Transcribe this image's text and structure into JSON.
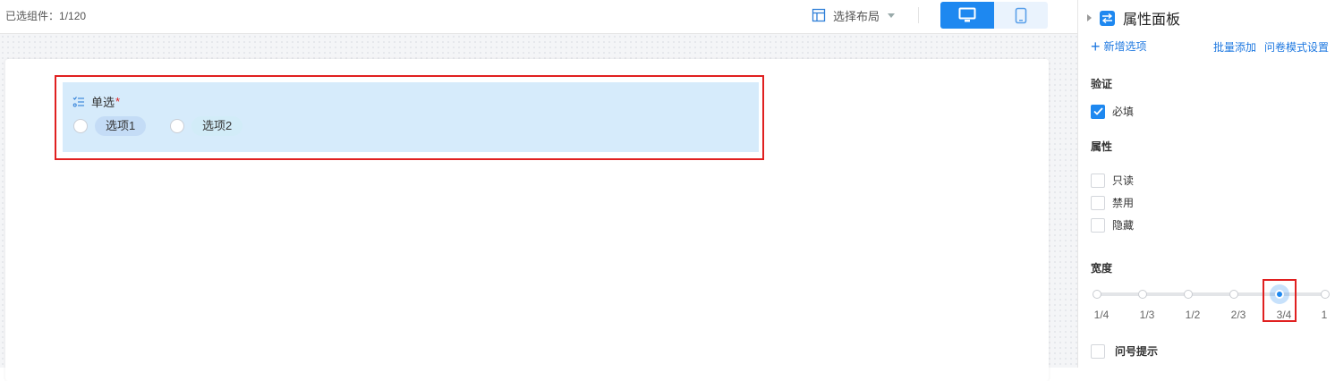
{
  "toolbar": {
    "selected_label": "已选组件：",
    "selected_count": "1/120",
    "layout_label": "选择布局"
  },
  "field": {
    "title": "单选",
    "required_mark": "*",
    "options": [
      "选项1",
      "选项2"
    ]
  },
  "panel": {
    "title": "属性面板",
    "add_option": "新增选项",
    "batch_add": "批量添加",
    "survey_settings": "问卷模式设置",
    "validation": {
      "title": "验证",
      "required_label": "必填",
      "required_checked": true
    },
    "attributes": {
      "title": "属性",
      "readonly": "只读",
      "disabled": "禁用",
      "hidden": "隐藏"
    },
    "width": {
      "title": "宽度",
      "marks": [
        "1/4",
        "1/3",
        "1/2",
        "2/3",
        "3/4",
        "1"
      ],
      "selected": "3/4"
    },
    "question_hint": "问号提示"
  },
  "colors": {
    "primary": "#1e88f0",
    "highlight": "#e02020",
    "field_bg": "#d6ebfb"
  }
}
